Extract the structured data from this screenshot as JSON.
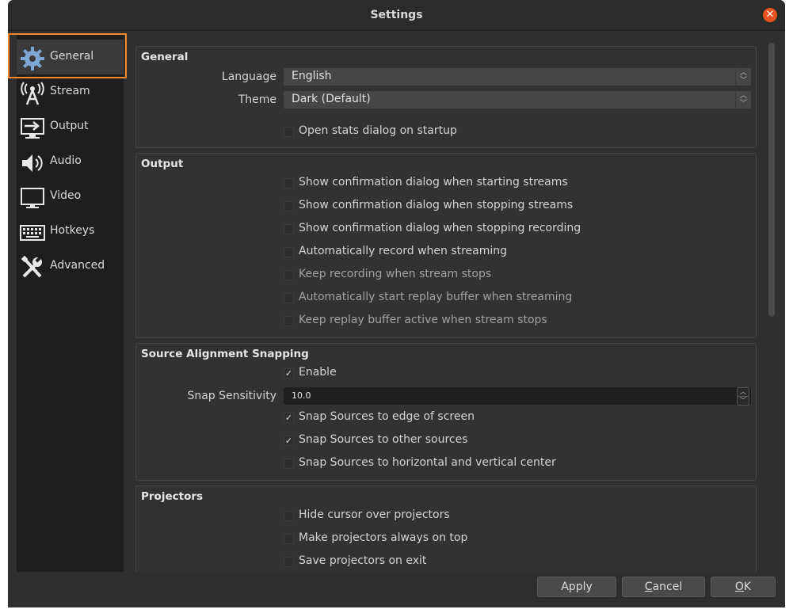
{
  "window": {
    "title": "Settings"
  },
  "sidebar": {
    "items": [
      {
        "label": "General",
        "icon": "gear-icon"
      },
      {
        "label": "Stream",
        "icon": "antenna-icon"
      },
      {
        "label": "Output",
        "icon": "output-monitor-icon"
      },
      {
        "label": "Audio",
        "icon": "speaker-icon"
      },
      {
        "label": "Video",
        "icon": "monitor-icon"
      },
      {
        "label": "Hotkeys",
        "icon": "keyboard-icon"
      },
      {
        "label": "Advanced",
        "icon": "tools-icon"
      }
    ],
    "selected": "General"
  },
  "general": {
    "title": "General",
    "language_label": "Language",
    "language_value": "English",
    "theme_label": "Theme",
    "theme_value": "Dark (Default)",
    "open_stats": "Open stats dialog on startup"
  },
  "output": {
    "title": "Output",
    "options": [
      "Show confirmation dialog when starting streams",
      "Show confirmation dialog when stopping streams",
      "Show confirmation dialog when stopping recording",
      "Automatically record when streaming",
      "Keep recording when stream stops",
      "Automatically start replay buffer when streaming",
      "Keep replay buffer active when stream stops"
    ]
  },
  "snapping": {
    "title": "Source Alignment Snapping",
    "enable": "Enable",
    "sensitivity_label": "Snap Sensitivity",
    "sensitivity_value": "10.0",
    "to_edge": "Snap Sources to edge of screen",
    "to_sources": "Snap Sources to other sources",
    "to_center": "Snap Sources to horizontal and vertical center"
  },
  "projectors": {
    "title": "Projectors",
    "hide_cursor": "Hide cursor over projectors",
    "always_on_top": "Make projectors always on top",
    "save_on_exit": "Save projectors on exit"
  },
  "buttons": {
    "apply": "Apply",
    "cancel_first": "C",
    "cancel_rest": "ancel",
    "ok_first": "O",
    "ok_rest": "K"
  },
  "colors": {
    "accent": "#f3892a",
    "close": "#e95420"
  }
}
